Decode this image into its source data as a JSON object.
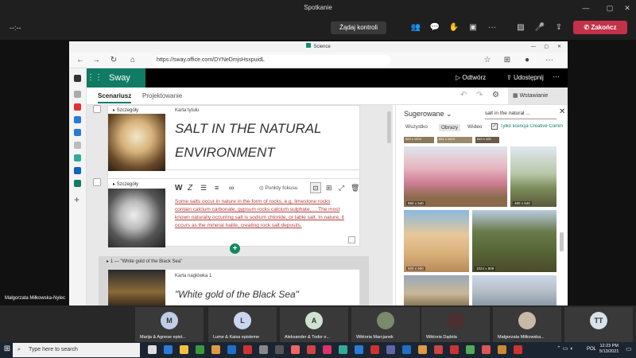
{
  "teams": {
    "window_title": "Spotkanie",
    "timer": "--:--",
    "request_control": "Żądaj kontroli",
    "end_call": "Zakończ",
    "presenter_name": "Małgorzata Miłkowska-Nylec",
    "participants": [
      {
        "initial": "M",
        "name": "Marija & Agnese epist...",
        "color": "#bfcde6"
      },
      {
        "initial": "L",
        "name": "Lume & Kaisa episteme",
        "color": "#c9d6f0"
      },
      {
        "initial": "A",
        "name": "Aleksander & Todor e...",
        "color": "#cfe4cf"
      },
      {
        "initial": "",
        "name": "Wiktoria Marcjanek",
        "color": "#7a8a6a"
      },
      {
        "initial": "",
        "name": "Wiktoria Dądela",
        "color": "#4a3030"
      },
      {
        "initial": "",
        "name": "Małgorzata Miłkowska...",
        "color": "#c8b8a8"
      },
      {
        "initial": "TT",
        "name": "",
        "color": "#d7e2ec"
      }
    ]
  },
  "browser": {
    "tab_title": "Science",
    "url": "https://sway.office.com/DYNeDmjsHsxpuidL"
  },
  "sway": {
    "app_name": "Sway",
    "play": "Odtwórz",
    "share": "Udostępnij",
    "tab_storyline": "Scenariusz",
    "tab_design": "Projektowanie",
    "insert": "Wstawianie",
    "details": "Szczegóły",
    "card1_label": "Karta tytułu",
    "card1_title": "SALT IN THE NATURAL ENVIRONMENT",
    "focus_points": "Punkty fokusu",
    "card2_text": "Some salts occur in nature in the form of rocks, e.g. limestone rocks contain calcium carbonate, gypsum rocks calcium sulphate, ... The most known naturally occurring salt is sodium chloride, or table salt. In nature, it occurs as the mineral halite, creating rock salt deposits.",
    "section_label": "1 — \"White gold of the Black Sea\"",
    "card3_label": "Karta nagłówka 1",
    "card3_title": "\"White gold of the Black Sea\""
  },
  "panel": {
    "suggested": "Sugerowane",
    "search_value": "salt in the natural ...",
    "filter_all": "Wszystko",
    "filter_images": "Obrazy",
    "filter_video": "Wideo",
    "cc_only": "Tylko licencja Creative Comm",
    "sizes": [
      "683 x 1024",
      "851 x 1024",
      "640 x 426",
      "960 x 540",
      "480 x 640",
      "500 x 500",
      "1024 x 809"
    ]
  },
  "taskbar": {
    "search": "Type here to search",
    "time": "12:23 PM",
    "date": "5/13/2021",
    "lang": "POL"
  }
}
